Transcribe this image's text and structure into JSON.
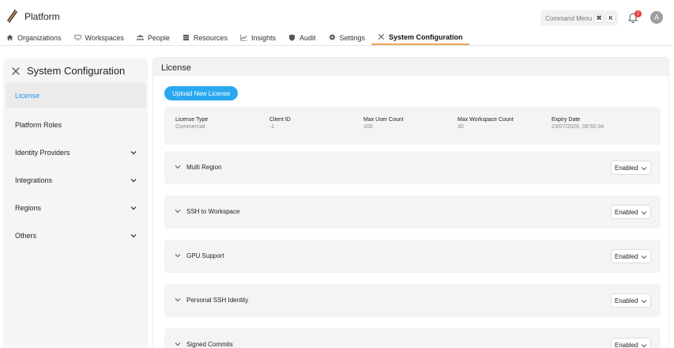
{
  "app": {
    "title": "Platform",
    "brand_color": "#f0a35a"
  },
  "command_menu": {
    "label": "Command Menu",
    "keys": [
      "⌘",
      "K"
    ]
  },
  "notifications": {
    "count": "2",
    "icon": "bell-icon"
  },
  "user": {
    "avatar_letter": "A"
  },
  "nav": {
    "items": [
      {
        "label": "Organizations",
        "icon": "home-icon"
      },
      {
        "label": "Workspaces",
        "icon": "monitor-icon"
      },
      {
        "label": "People",
        "icon": "people-icon"
      },
      {
        "label": "Resources",
        "icon": "database-icon"
      },
      {
        "label": "Insights",
        "icon": "chart-icon"
      },
      {
        "label": "Audit",
        "icon": "shield-icon"
      },
      {
        "label": "Settings",
        "icon": "gear-icon"
      },
      {
        "label": "System Configuration",
        "icon": "tools-icon"
      }
    ]
  },
  "sidebar": {
    "title": "System Configuration",
    "items": [
      {
        "label": "License"
      },
      {
        "label": "Platform Roles"
      },
      {
        "label": "Identity Providers"
      },
      {
        "label": "Integrations"
      },
      {
        "label": "Regions"
      },
      {
        "label": "Others"
      }
    ]
  },
  "main": {
    "title": "License",
    "upload_label": "Upload New License",
    "license": {
      "type_label": "License Type",
      "type_value": "Commercial",
      "client_label": "Client ID",
      "client_value": "-1",
      "users_label": "Max User Count",
      "users_value": "100",
      "workspaces_label": "Max Workspace Count",
      "workspaces_value": "30",
      "expiry_label": "Expiry Date",
      "expiry_value": "23/07/2026, 08:50:34"
    },
    "features": [
      {
        "name": "Multi Region",
        "value": "Enabled"
      },
      {
        "name": "SSH to Workspace",
        "value": "Enabled"
      },
      {
        "name": "GPU Support",
        "value": "Enabled"
      },
      {
        "name": "Personal SSH Identity",
        "value": "Enabled"
      },
      {
        "name": "Signed Commits",
        "value": "Enabled"
      }
    ]
  }
}
